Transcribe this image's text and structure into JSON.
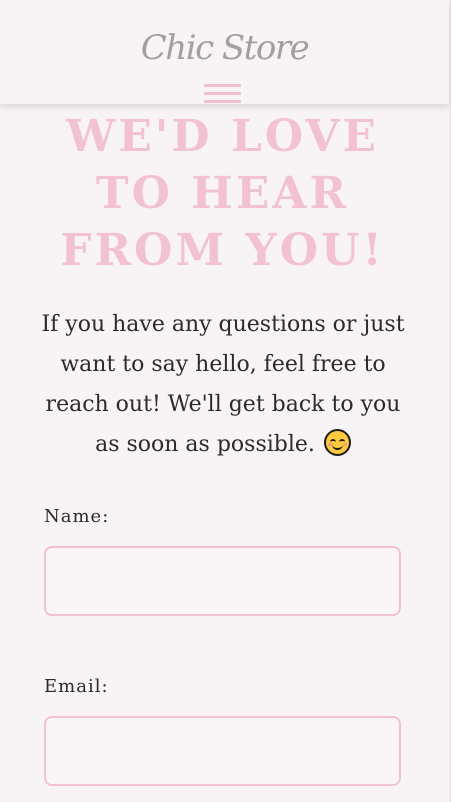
{
  "header": {
    "logo_text": "Chic Store",
    "menu_icon": "hamburger-menu-icon"
  },
  "hero": {
    "title": "We'd Love to Hear From You!",
    "intro_text": "If you have any questions or just want to say hello, feel free to reach out! We'll get back to you as soon as possible.",
    "intro_emoji": "smiling-face-icon"
  },
  "form": {
    "name_label": "Name:",
    "name_value": "",
    "email_label": "Email:",
    "email_value": ""
  },
  "colors": {
    "accent_pink": "#f2c2d3",
    "background": "#f8f3f5",
    "text": "#2b2b2b",
    "logo": "#a39ea2"
  }
}
